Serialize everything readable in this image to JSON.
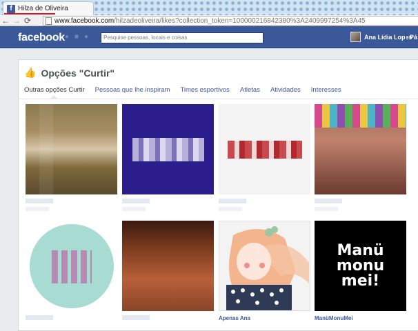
{
  "browser": {
    "tab_title": "Hilza de Oliveira",
    "url_host": "www.facebook.com",
    "url_path": "/hilzadeoliveira/likes?collection_token=100000216842380%3A2409997254%3A45"
  },
  "header": {
    "logo": "facebook",
    "search_placeholder": "Pesquise pessoas, locais e coisas",
    "user_name": "Ana Lídia Lopes",
    "home_label": "Pá"
  },
  "page": {
    "title": "Opções \"Curtir\"",
    "tabs": [
      {
        "label": "Outras opções Curtir",
        "active": true
      },
      {
        "label": "Pessoas que lhe inspiram",
        "active": false
      },
      {
        "label": "Times esportivos",
        "active": false
      },
      {
        "label": "Atletas",
        "active": false
      },
      {
        "label": "Atividades",
        "active": false
      },
      {
        "label": "Interesses",
        "active": false
      }
    ]
  },
  "cards": [
    {
      "label": ""
    },
    {
      "label": ""
    },
    {
      "label": ""
    },
    {
      "label": ""
    },
    {
      "label": ""
    },
    {
      "label": ""
    },
    {
      "label": "Apenas Ana"
    },
    {
      "label": "ManüMonuMei"
    }
  ],
  "logo_card": {
    "line1": "Manü",
    "line2": "monu",
    "line3": "mei!"
  },
  "colors": {
    "fb_blue": "#3b5998",
    "tab_underline": "#e0101a"
  }
}
